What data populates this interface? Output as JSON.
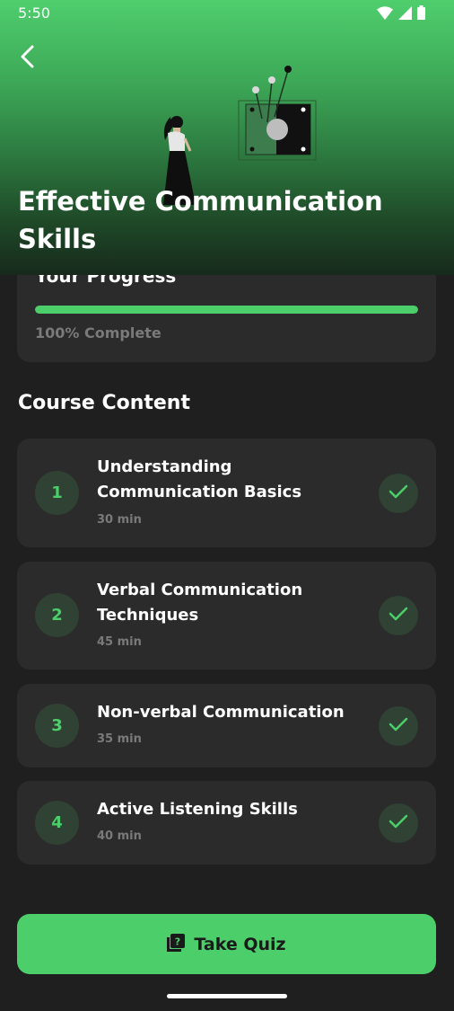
{
  "status_bar": {
    "time": "5:50",
    "icons": [
      "wifi-icon",
      "signal-icon",
      "battery-icon"
    ]
  },
  "header": {
    "back_icon": "back-arrow-icon",
    "course_title": "Effective Communication Skills",
    "illustration": "woman-with-device-illustration"
  },
  "progress": {
    "title": "Your Progress",
    "percent": 100,
    "label": "100% Complete"
  },
  "content": {
    "section_title": "Course Content",
    "lessons": [
      {
        "number": "1",
        "title": "Understanding Communication Basics",
        "duration": "30 min",
        "completed": true
      },
      {
        "number": "2",
        "title": "Verbal Communication Techniques",
        "duration": "45 min",
        "completed": true
      },
      {
        "number": "3",
        "title": "Non-verbal Communication",
        "duration": "35 min",
        "completed": true
      },
      {
        "number": "4",
        "title": "Active Listening Skills",
        "duration": "40 min",
        "completed": true
      }
    ]
  },
  "quiz_button": {
    "label": "Take Quiz",
    "icon": "quiz-icon"
  },
  "colors": {
    "accent": "#4ccf6a",
    "background": "#1f1f1f",
    "card": "#2b2b2b",
    "muted_text": "#7a7a7a"
  }
}
